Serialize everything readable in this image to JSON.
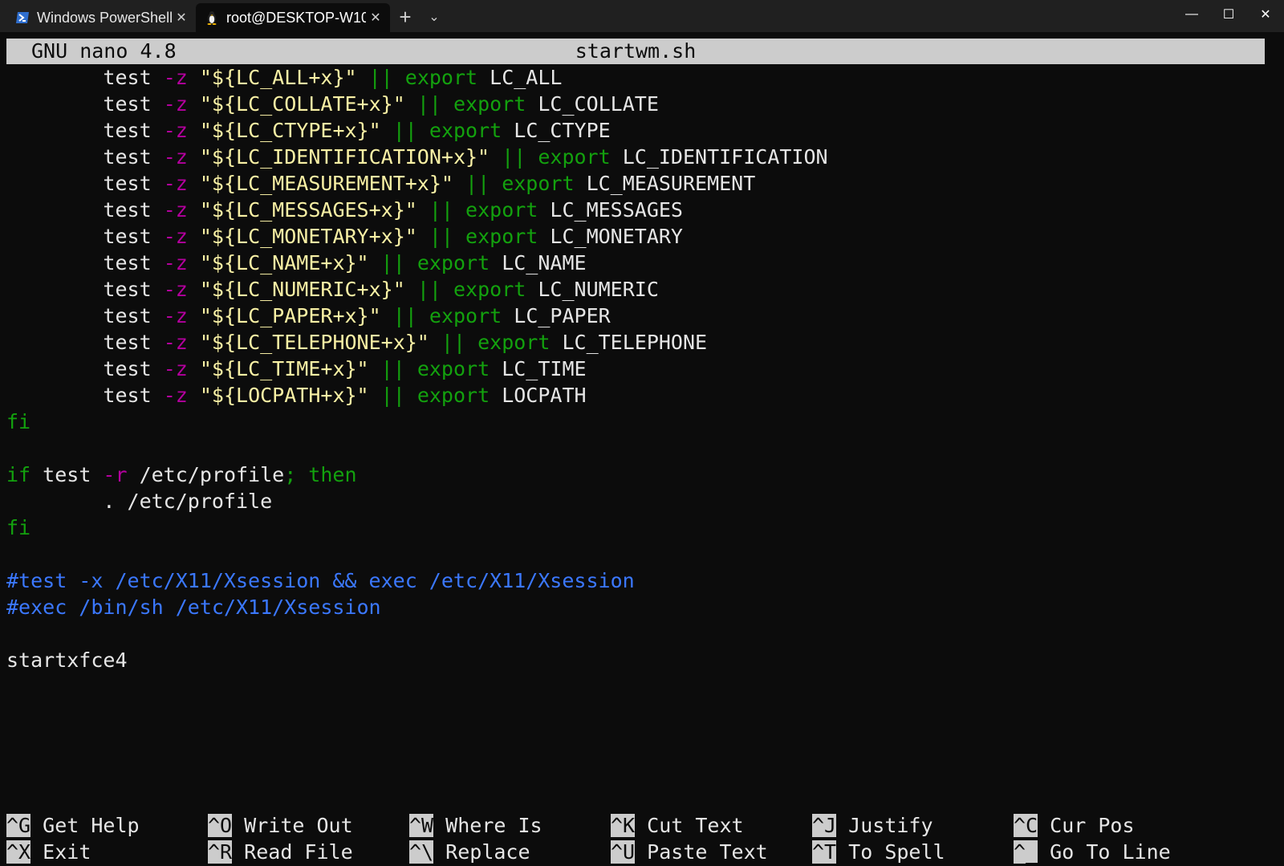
{
  "window": {
    "tabs": [
      {
        "label": "Windows PowerShell",
        "icon": "powershell-icon",
        "active": false
      },
      {
        "label": "root@DESKTOP-W10",
        "icon": "linux-penguin-icon",
        "active": true
      }
    ],
    "new_tab_glyph": "+",
    "dropdown_glyph": "⌄",
    "controls": {
      "minimize": "—",
      "maximize": "☐",
      "close": "✕"
    }
  },
  "nano": {
    "version": "GNU nano 4.8",
    "filename": "startwm.sh"
  },
  "lines": [
    {
      "indent": "        ",
      "cmd": "test",
      "opt": "-z",
      "str": "\"${LC_ALL+x}\"",
      "op": "||",
      "kw": "export",
      "var": "LC_ALL"
    },
    {
      "indent": "        ",
      "cmd": "test",
      "opt": "-z",
      "str": "\"${LC_COLLATE+x}\"",
      "op": "||",
      "kw": "export",
      "var": "LC_COLLATE"
    },
    {
      "indent": "        ",
      "cmd": "test",
      "opt": "-z",
      "str": "\"${LC_CTYPE+x}\"",
      "op": "||",
      "kw": "export",
      "var": "LC_CTYPE"
    },
    {
      "indent": "        ",
      "cmd": "test",
      "opt": "-z",
      "str": "\"${LC_IDENTIFICATION+x}\"",
      "op": "||",
      "kw": "export",
      "var": "LC_IDENTIFICATION"
    },
    {
      "indent": "        ",
      "cmd": "test",
      "opt": "-z",
      "str": "\"${LC_MEASUREMENT+x}\"",
      "op": "||",
      "kw": "export",
      "var": "LC_MEASUREMENT"
    },
    {
      "indent": "        ",
      "cmd": "test",
      "opt": "-z",
      "str": "\"${LC_MESSAGES+x}\"",
      "op": "||",
      "kw": "export",
      "var": "LC_MESSAGES"
    },
    {
      "indent": "        ",
      "cmd": "test",
      "opt": "-z",
      "str": "\"${LC_MONETARY+x}\"",
      "op": "||",
      "kw": "export",
      "var": "LC_MONETARY"
    },
    {
      "indent": "        ",
      "cmd": "test",
      "opt": "-z",
      "str": "\"${LC_NAME+x}\"",
      "op": "||",
      "kw": "export",
      "var": "LC_NAME"
    },
    {
      "indent": "        ",
      "cmd": "test",
      "opt": "-z",
      "str": "\"${LC_NUMERIC+x}\"",
      "op": "||",
      "kw": "export",
      "var": "LC_NUMERIC"
    },
    {
      "indent": "        ",
      "cmd": "test",
      "opt": "-z",
      "str": "\"${LC_PAPER+x}\"",
      "op": "||",
      "kw": "export",
      "var": "LC_PAPER"
    },
    {
      "indent": "        ",
      "cmd": "test",
      "opt": "-z",
      "str": "\"${LC_TELEPHONE+x}\"",
      "op": "||",
      "kw": "export",
      "var": "LC_TELEPHONE"
    },
    {
      "indent": "        ",
      "cmd": "test",
      "opt": "-z",
      "str": "\"${LC_TIME+x}\"",
      "op": "||",
      "kw": "export",
      "var": "LC_TIME"
    },
    {
      "indent": "        ",
      "cmd": "test",
      "opt": "-z",
      "str": "\"${LOCPATH+x}\"",
      "op": "||",
      "kw": "export",
      "var": "LOCPATH"
    }
  ],
  "block": {
    "fi_1": "fi",
    "if_kw": "if",
    "if_cmd": " test ",
    "if_opt": "-r",
    "if_path": " /etc/profile",
    "if_then": "; then",
    "source_line": "        . /etc/profile",
    "fi_2": "fi",
    "comment_1": "#test -x /etc/X11/Xsession && exec /etc/X11/Xsession",
    "comment_2": "#exec /bin/sh /etc/X11/Xsession",
    "last_cmd": "startxfce4"
  },
  "shortcuts": [
    {
      "key": "^G",
      "label": "Get Help"
    },
    {
      "key": "^X",
      "label": "Exit"
    },
    {
      "key": "^O",
      "label": "Write Out"
    },
    {
      "key": "^R",
      "label": "Read File"
    },
    {
      "key": "^W",
      "label": "Where Is"
    },
    {
      "key": "^\\",
      "label": "Replace"
    },
    {
      "key": "^K",
      "label": "Cut Text"
    },
    {
      "key": "^U",
      "label": "Paste Text"
    },
    {
      "key": "^J",
      "label": "Justify"
    },
    {
      "key": "^T",
      "label": "To Spell"
    },
    {
      "key": "^C",
      "label": "Cur Pos"
    },
    {
      "key": "^_",
      "label": "Go To Line"
    }
  ],
  "colors": {
    "background": "#0c0c0c",
    "keyword": "#13a10e",
    "option": "#b4009e",
    "string": "#f9f1a5",
    "comment": "#3b78ff",
    "text": "#e6e6e6",
    "header_bg": "#cccccc"
  }
}
